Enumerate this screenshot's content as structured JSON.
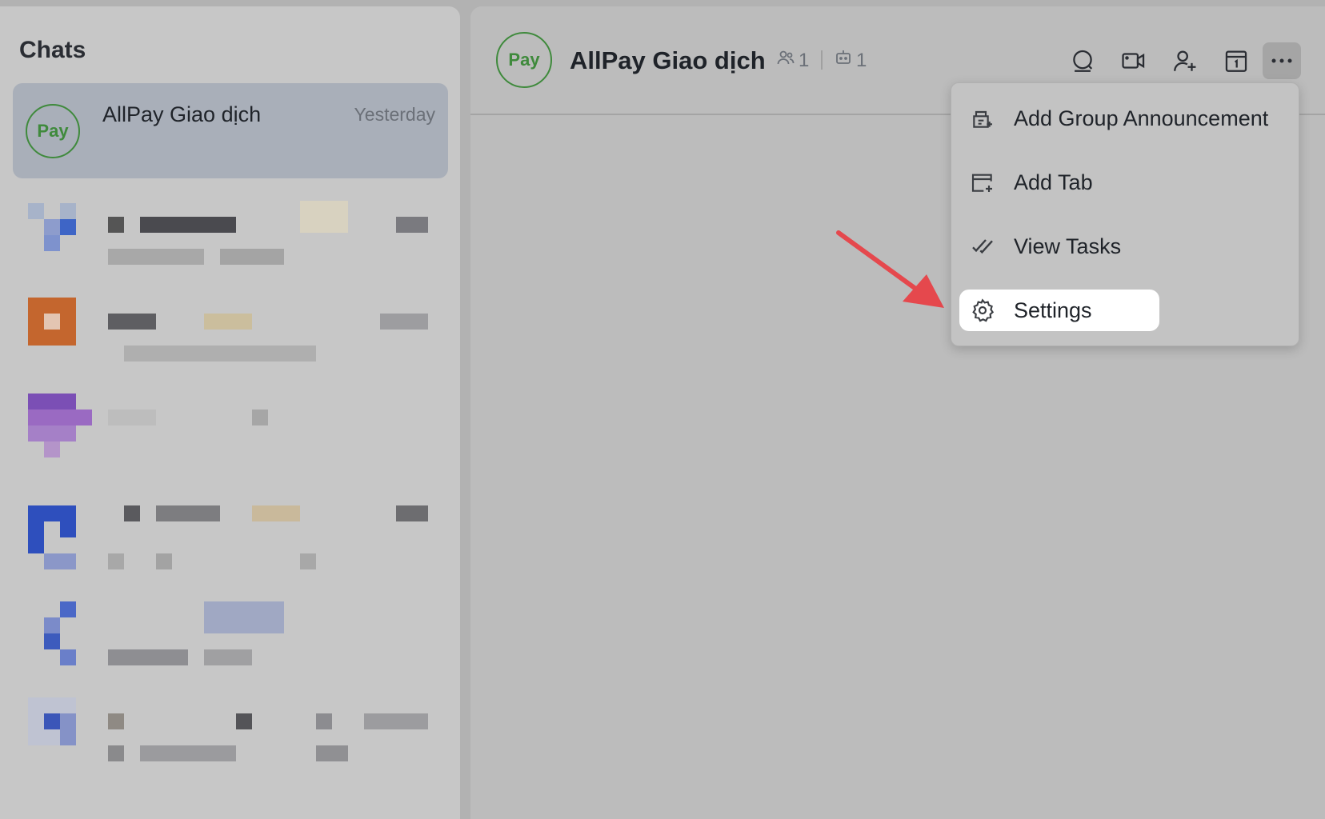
{
  "sidebar": {
    "title": "Chats",
    "active_chat": {
      "name": "AllPay Giao dịch",
      "time": "Yesterday",
      "avatar_text": "Pay"
    }
  },
  "header": {
    "avatar_text": "Pay",
    "title": "AllPay Giao dịch",
    "members_count": "1",
    "bots_count": "1",
    "icons": [
      "search-icon",
      "video-call-icon",
      "add-member-icon",
      "calendar-icon",
      "more-icon"
    ]
  },
  "menu": {
    "items": [
      {
        "label": "Add Group Announcement",
        "icon": "announcement-icon"
      },
      {
        "label": "Add Tab",
        "icon": "add-tab-icon"
      },
      {
        "label": "View Tasks",
        "icon": "tasks-icon"
      },
      {
        "label": "Settings",
        "icon": "gear-icon"
      }
    ],
    "highlighted": "Settings"
  },
  "colors": {
    "accent_green": "#3f8a3c",
    "arrow_red": "#e5484d"
  }
}
